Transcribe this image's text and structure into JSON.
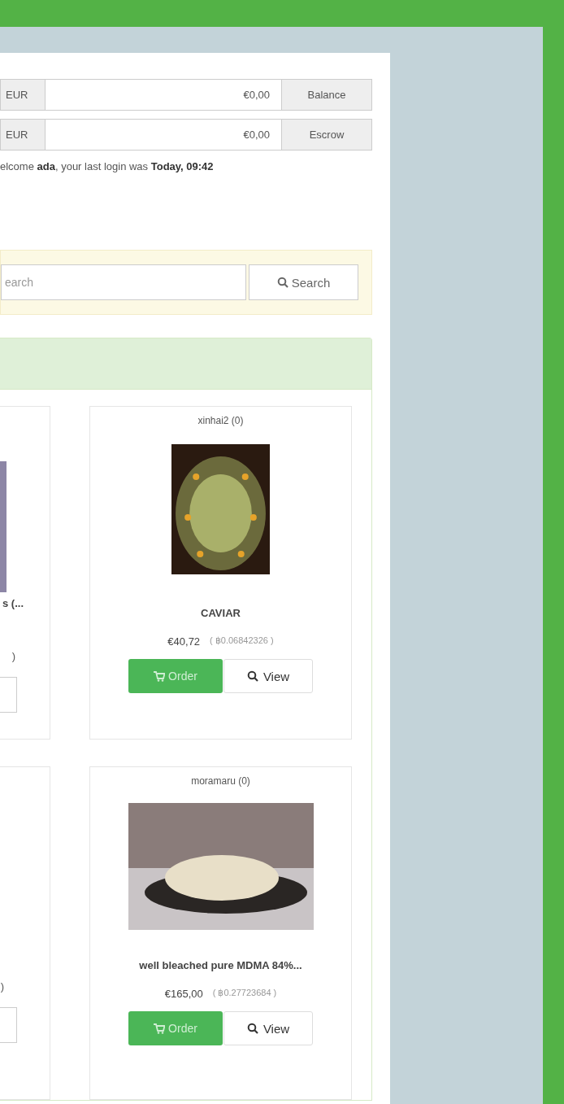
{
  "wallet": [
    {
      "currency": "EUR",
      "amount": "€0,00",
      "label": "Balance"
    },
    {
      "currency": "EUR",
      "amount": "€0,00",
      "label": "Escrow"
    }
  ],
  "welcome": "elcome **ada**, your last login was **Today, 09:42**",
  "search": {
    "placeholder": "earch",
    "button": "Search"
  },
  "listings": [
    [
      {
        "kind": "partial",
        "has_image": true,
        "title": "s (...",
        "price": ")"
      },
      {
        "kind": "full",
        "vendor": "xinhai2 (0)",
        "title": "CAVIAR",
        "price": "€40,72",
        "btc": "( ฿0.06842326 )",
        "order": "Order",
        "view": "View"
      }
    ],
    [
      {
        "kind": "partial",
        "has_image": false,
        "price": ")"
      },
      {
        "kind": "full",
        "vendor": "moramaru (0)",
        "title": "well bleached pure MDMA 84%...",
        "price": "€165,00",
        "btc": "( ฿0.27723684 )",
        "order": "Order",
        "view": "View"
      }
    ]
  ]
}
